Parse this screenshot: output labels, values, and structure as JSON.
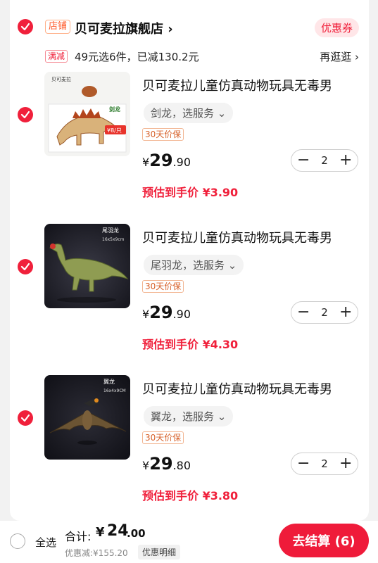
{
  "colors": {
    "accent": "#f0203b",
    "card": "#ffffff",
    "background": "#f2f2f2"
  },
  "store": {
    "tag": "店铺",
    "name": "贝可麦拉旗舰店 ›",
    "coupon": "优惠券"
  },
  "promo": {
    "tag": "满减",
    "text": "49元选6件，已减130.2元",
    "link": "再逛逛 ›"
  },
  "items": [
    {
      "title": "贝可麦拉儿童仿真动物玩具无毒男",
      "variant": "剑龙，选服务 ⌄",
      "warranty": "30天价保",
      "price_cur": "¥",
      "price_int": "29",
      "price_dec": ".90",
      "qty": "2",
      "estimate": "预估到手价 ¥3.90",
      "thumb": {
        "brand": "贝可麦拉",
        "name": "剑龙",
        "price_tag": "¥8/只"
      }
    },
    {
      "title": "贝可麦拉儿童仿真动物玩具无毒男",
      "variant": "尾羽龙，选服务 ⌄",
      "warranty": "30天价保",
      "price_cur": "¥",
      "price_int": "29",
      "price_dec": ".90",
      "qty": "2",
      "estimate": "预估到手价 ¥4.30",
      "thumb": {
        "name": "尾羽龙",
        "size": "16x5x9cm"
      }
    },
    {
      "title": "贝可麦拉儿童仿真动物玩具无毒男",
      "variant": "翼龙，选服务 ⌄",
      "warranty": "30天价保",
      "price_cur": "¥",
      "price_int": "29",
      "price_dec": ".80",
      "qty": "2",
      "estimate": "预估到手价 ¥3.80",
      "thumb": {
        "name": "翼龙",
        "size": "16x4x9CM"
      }
    }
  ],
  "footer": {
    "select_all": "全选",
    "total_label": "合计:",
    "total_cur": "¥",
    "total_int": "24",
    "total_dec": ".00",
    "discount": "优惠减:¥155.20",
    "detail": "优惠明细",
    "checkout": "去结算 (6)"
  }
}
